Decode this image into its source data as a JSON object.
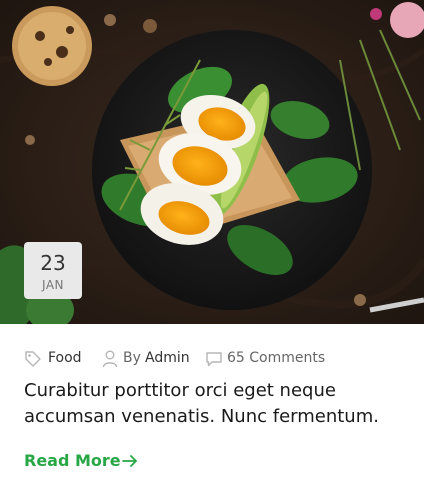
{
  "post": {
    "date": {
      "day": "23",
      "month": "JAN"
    },
    "meta": {
      "category": "Food",
      "by_prefix": "By",
      "author": "Admin",
      "comments": "65 Comments"
    },
    "title": "Curabitur porttitor orci eget neque accumsan venenatis. Nunc fermentum.",
    "read_more": "Read More"
  },
  "colors": {
    "accent": "#28a745",
    "badge_bg": "#e9e9e9",
    "text_dark": "#1a1a1a",
    "text_muted": "#666666"
  },
  "icons": {
    "category": "tag-icon",
    "author": "user-icon",
    "comments": "comment-icon",
    "read_more": "arrow-right-icon"
  }
}
